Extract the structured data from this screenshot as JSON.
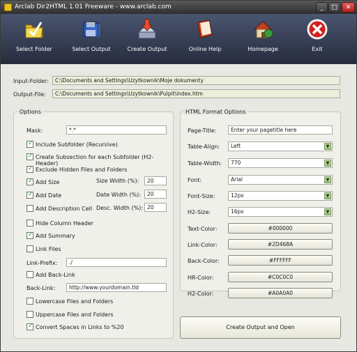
{
  "window": {
    "title": "Arclab Dir2HTML 1.01 Freeware - www.arclab.com"
  },
  "toolbar": {
    "select_folder": "Select Folder",
    "select_output": "Select Output",
    "create_output": "Create Output",
    "online_help": "Online Help",
    "homepage": "Homepage",
    "exit": "Exit"
  },
  "paths": {
    "input_label": "Input-Folder:",
    "input_value": "C:\\Documents and Settings\\Uzytkownik\\Moje dokumenty",
    "output_label": "Output-File:",
    "output_value": "C:\\Documents and Settings\\Uzytkownik\\Pulpit\\index.htm"
  },
  "options": {
    "title": "Options",
    "mask_label": "Mask:",
    "mask_value": "*.*",
    "include_subfolder": "Include Subfolder (Recursive)",
    "create_subsection": "Create Subsection for each Subfolder (H2-Header)",
    "exclude_hidden": "Exclude Hidden Files and Folders",
    "add_size": "Add Size",
    "add_date": "Add Date",
    "add_description": "Add Description Cell",
    "size_width_label": "Size Width (%):",
    "size_width_value": "20",
    "date_width_label": "Date Width (%):",
    "date_width_value": "20",
    "desc_width_label": "Desc. Width (%):",
    "desc_width_value": "20",
    "hide_column_header": "Hide Column Header",
    "add_summary": "Add Summary",
    "link_files": "Link Files",
    "link_prefix_label": "Link-Prefix:",
    "link_prefix_value": "./",
    "add_back_link": "Add Back-Link",
    "back_link_label": "Back-Link:",
    "back_link_value": "http://www.yourdomain.tld",
    "lowercase": "Lowercase Files and Folders",
    "uppercase": "Uppercase Files and Folders",
    "convert_spaces": "Convert Spaces in Links to %20"
  },
  "html_format": {
    "title": "HTML Format Options",
    "page_title_label": "Page-Title:",
    "page_title_value": "Enter your pagetitle here",
    "table_align_label": "Table-Align:",
    "table_align_value": "Left",
    "table_width_label": "Table-Width:",
    "table_width_value": "770",
    "font_label": "Font:",
    "font_value": "Arial",
    "font_size_label": "Font-Size:",
    "font_size_value": "12px",
    "h2_size_label": "H2-Size:",
    "h2_size_value": "16px",
    "text_color_label": "Text-Color:",
    "text_color_value": "#000000",
    "link_color_label": "Link-Color:",
    "link_color_value": "#2D468A",
    "back_color_label": "Back-Color:",
    "back_color_value": "#FFFFFF",
    "hr_color_label": "HR-Color:",
    "hr_color_value": "#C0C0C0",
    "h2_color_label": "H2-Color:",
    "h2_color_value": "#A0A0A0",
    "create_open_button": "Create Output and Open"
  },
  "colors": {
    "accent_checkbox": "#21a121",
    "toolbar_bg": "#2c3446"
  }
}
